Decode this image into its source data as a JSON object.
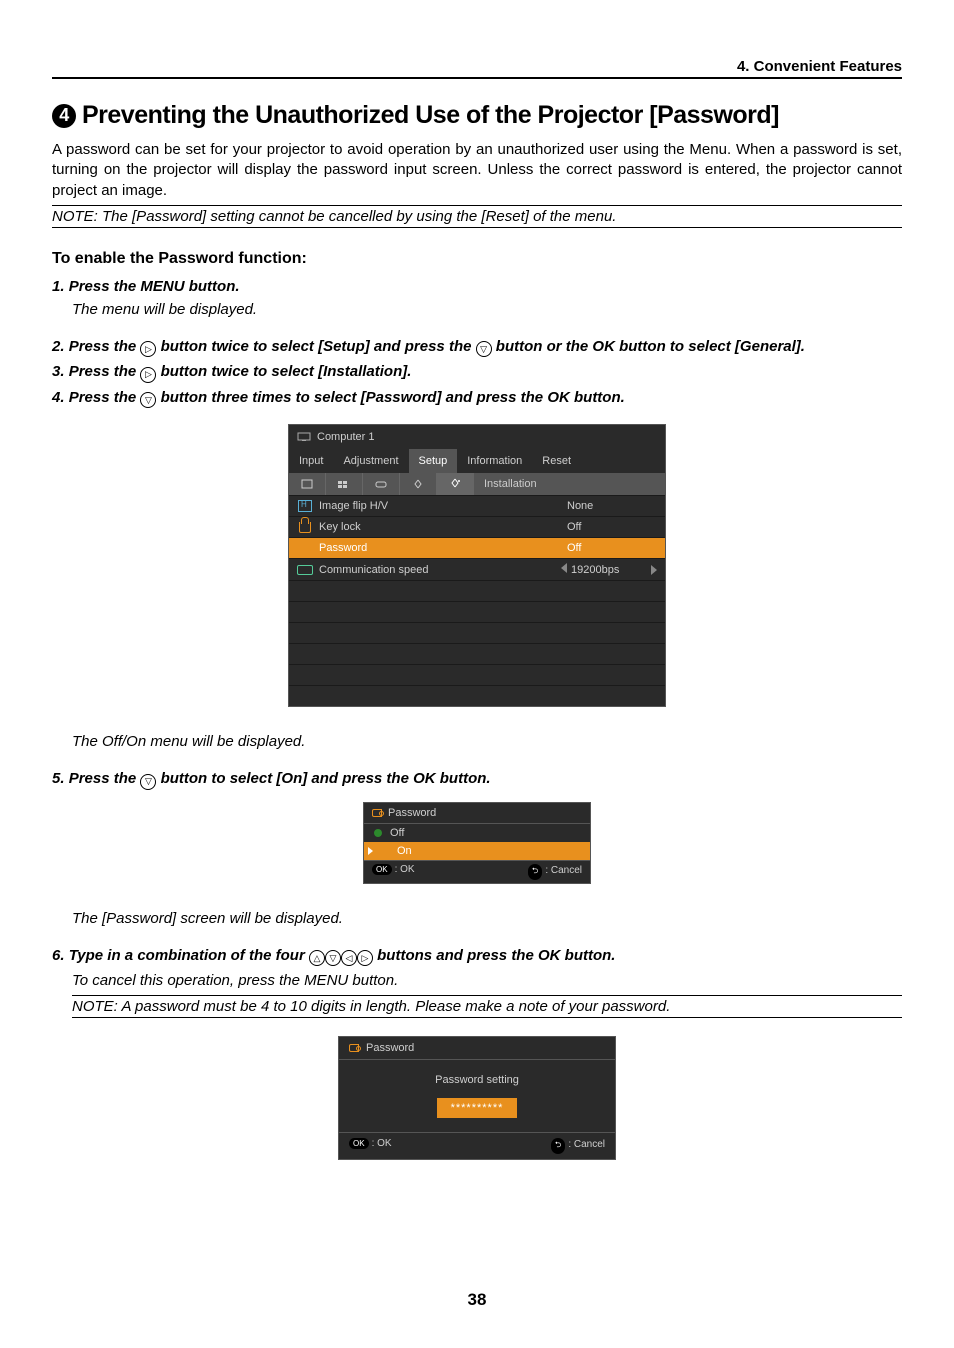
{
  "header": {
    "section_title": "4. Convenient Features"
  },
  "title": {
    "bullet_num": "4",
    "text": "Preventing the Unauthorized Use of the Projector [Password]"
  },
  "intro": "A password can be set for your projector to avoid operation by an unauthorized user using the Menu. When a password is set, turning on the projector will display the password input screen. Unless the correct password is entered, the projector cannot project an image.",
  "note_top": "NOTE: The [Password] setting cannot be cancelled by using the [Reset] of the menu.",
  "subheading": "To enable the Password function:",
  "steps": {
    "s1": {
      "num": "1.",
      "text": "Press the MENU button."
    },
    "s1_sub": "The menu will be displayed.",
    "s2": {
      "num": "2.",
      "pre": "Press the ",
      "mid": " button twice to select [Setup] and press the ",
      "post": " button or the OK button to select [General]."
    },
    "s3": {
      "num": "3.",
      "pre": "Press the ",
      "post": " button twice to select [Installation]."
    },
    "s4": {
      "num": "4.",
      "pre": "Press the ",
      "post": " button three times to select [Password] and press the OK button."
    },
    "s4_sub": "The Off/On menu will be displayed.",
    "s5": {
      "num": "5.",
      "pre": "Press the ",
      "post": " button to select [On] and press the OK button."
    },
    "s5_sub": "The [Password] screen will be displayed.",
    "s6": {
      "num": "6.",
      "pre": "Type in a combination of the four ",
      "post": " buttons and press the OK button."
    },
    "s6_sub": "To cancel this operation, press the MENU button.",
    "s6_note": "NOTE: A password must be 4 to 10 digits in length. Please make a note of your password."
  },
  "osd1": {
    "src_label": "Computer 1",
    "tabs": [
      "Input",
      "Adjustment",
      "Setup",
      "Information",
      "Reset"
    ],
    "active_tab_index": 2,
    "subtab_label": "Installation",
    "rows": [
      {
        "label": "Image flip H/V",
        "value": "None",
        "icon": "image-flip"
      },
      {
        "label": "Key lock",
        "value": "Off",
        "icon": "lock"
      },
      {
        "label": "Password",
        "value": "Off",
        "icon": "key",
        "highlight": true
      },
      {
        "label": "Communication speed",
        "value": "19200bps",
        "icon": "comm",
        "arrows": true
      }
    ]
  },
  "osd2": {
    "title": "Password",
    "off": "Off",
    "on": "On",
    "footer_ok": ": OK",
    "footer_ok_pill": "OK",
    "footer_cancel": ": Cancel",
    "footer_cancel_pill": "⮌"
  },
  "osd3": {
    "title": "Password",
    "body_label": "Password setting",
    "input_value": "**********",
    "footer_ok": ": OK",
    "footer_ok_pill": "OK",
    "footer_cancel": ": Cancel",
    "footer_cancel_pill": "⮌"
  },
  "page_num": "38"
}
